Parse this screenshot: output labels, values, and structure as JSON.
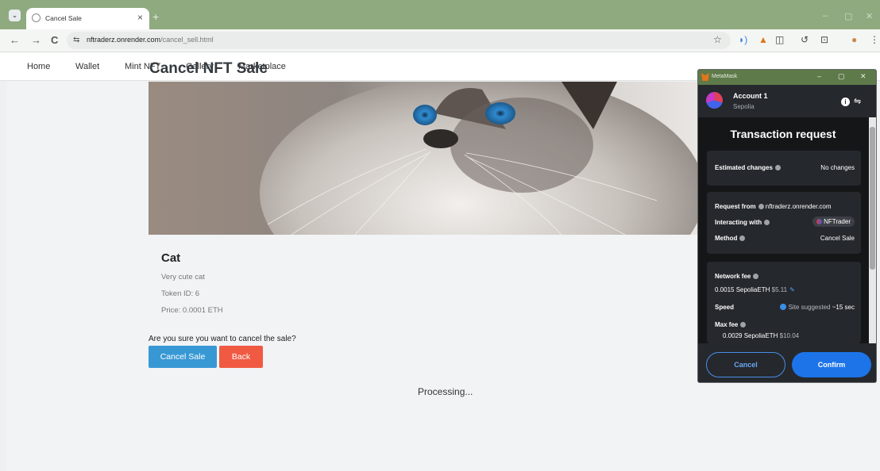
{
  "browser": {
    "tab_title": "Cancel Sale",
    "tab_close": "×",
    "new_tab": "+",
    "url_host": "nftraderz.onrender.com",
    "url_path": "/cancel_sell.html",
    "back": "←",
    "forward": "→",
    "reload": "C",
    "window_controls": {
      "minimize": "–",
      "restore": "▢",
      "close": "✕"
    },
    "toolbar_icons": [
      "star-icon",
      "audio-icon",
      "metamask-extension-icon",
      "extensions-icon",
      "history-icon",
      "downloads-icon",
      "profile-icon",
      "menu-icon"
    ]
  },
  "site_nav": {
    "items": [
      "Home",
      "Wallet",
      "Mint NFT",
      "Gallery",
      "Marketplace"
    ]
  },
  "main": {
    "title": "Cancel NFT Sale",
    "nft": {
      "name": "Cat",
      "description": "Very cute cat",
      "token_id": "Token ID: 6",
      "price": "Price: 0.0001 ETH"
    },
    "question": "Are you sure you want to cancel the sale?",
    "cancel_button": "Cancel Sale",
    "back_button": "Back",
    "status": "Processing..."
  },
  "metamask": {
    "window_title": "MetaMask",
    "account": "Account 1",
    "network": "Sepolia",
    "heading": "Transaction request",
    "estimated_changes_label": "Estimated changes",
    "estimated_changes_value": "No changes",
    "request_from_label": "Request from",
    "request_from_value": "nftraderz.onrender.com",
    "interacting_with_label": "Interacting with",
    "interacting_with_value": "NFTrader",
    "method_label": "Method",
    "method_value": "Cancel Sale",
    "network_fee_label": "Network fee",
    "network_fee_eth": "0.0015 SepoliaETH",
    "network_fee_usd": "$5.11",
    "speed_label": "Speed",
    "speed_value": "Site suggested",
    "speed_time": "~15 sec",
    "max_fee_label": "Max fee",
    "max_fee_eth": "0.0029 SepoliaETH",
    "max_fee_usd": "$10.04",
    "cancel_button": "Cancel",
    "confirm_button": "Confirm"
  },
  "colors": {
    "primary": "#3898d4",
    "danger": "#f05a43",
    "metamask_blue": "#1c74e8",
    "browser_frame": "#8faa7f"
  }
}
